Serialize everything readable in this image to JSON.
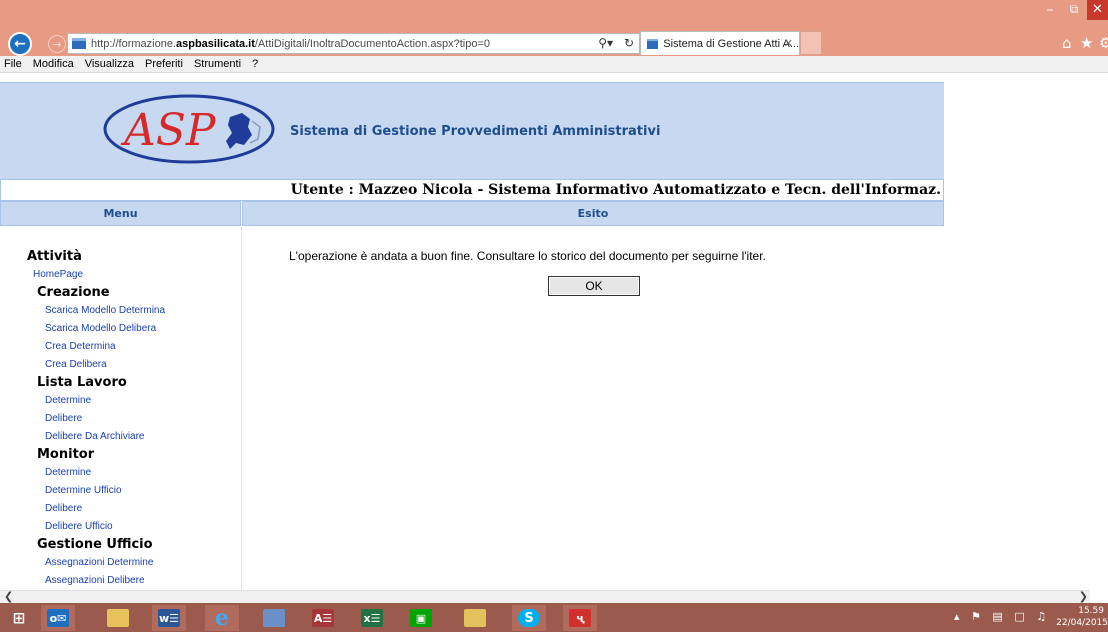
{
  "browser": {
    "url_prefix": "http://formazione.",
    "url_domain": "aspbasilicata.it",
    "url_path": "/AttiDigitali/InoltraDocumentoAction.aspx?tipo=0",
    "tab_title": "Sistema di Gestione Atti A...",
    "menu": [
      "File",
      "Modifica",
      "Visualizza",
      "Preferiti",
      "Strumenti",
      "?"
    ]
  },
  "header": {
    "logo_text": "ASP",
    "app_title": "Sistema di Gestione Provvedimenti Amministrativi",
    "user_line": "Utente : Mazzeo Nicola - Sistema Informativo Automatizzato e Tecn. dell'Informaz."
  },
  "columns": {
    "menu": "Menu",
    "result": "Esito"
  },
  "sidebar": {
    "attivita": "Attività",
    "homepage": "HomePage",
    "creazione": {
      "title": "Creazione",
      "items": [
        "Scarica Modello Determina",
        "Scarica Modello Delibera",
        "Crea Determina",
        "Crea Delibera"
      ]
    },
    "lista_lavoro": {
      "title": "Lista Lavoro",
      "items": [
        "Determine",
        "Delibere",
        "Delibere Da Archiviare"
      ]
    },
    "monitor": {
      "title": "Monitor",
      "items": [
        "Determine",
        "Determine Ufficio",
        "Delibere",
        "Delibere Ufficio"
      ]
    },
    "gestione_ufficio": {
      "title": "Gestione Ufficio",
      "items": [
        "Assegnazioni Determine",
        "Assegnazioni Delibere"
      ]
    }
  },
  "main": {
    "message": "L'operazione è andata a buon fine. Consultare lo storico del documento per seguirne l'iter.",
    "ok_label": "OK"
  },
  "taskbar": {
    "apps": [
      "start",
      "outlook",
      "explorer",
      "word",
      "internet-explorer",
      "remote-desktop",
      "access",
      "excel",
      "store",
      "photos",
      "skype",
      "acrobat"
    ],
    "time": "15.59",
    "date": "22/04/2015"
  },
  "colors": {
    "titlebar": "#e79a84",
    "banner": "#c6d9f1",
    "link": "#1a3fb0",
    "taskbar": "#9a5b4e",
    "logo_red": "#d62a2a",
    "logo_blue": "#1f3c9a"
  }
}
